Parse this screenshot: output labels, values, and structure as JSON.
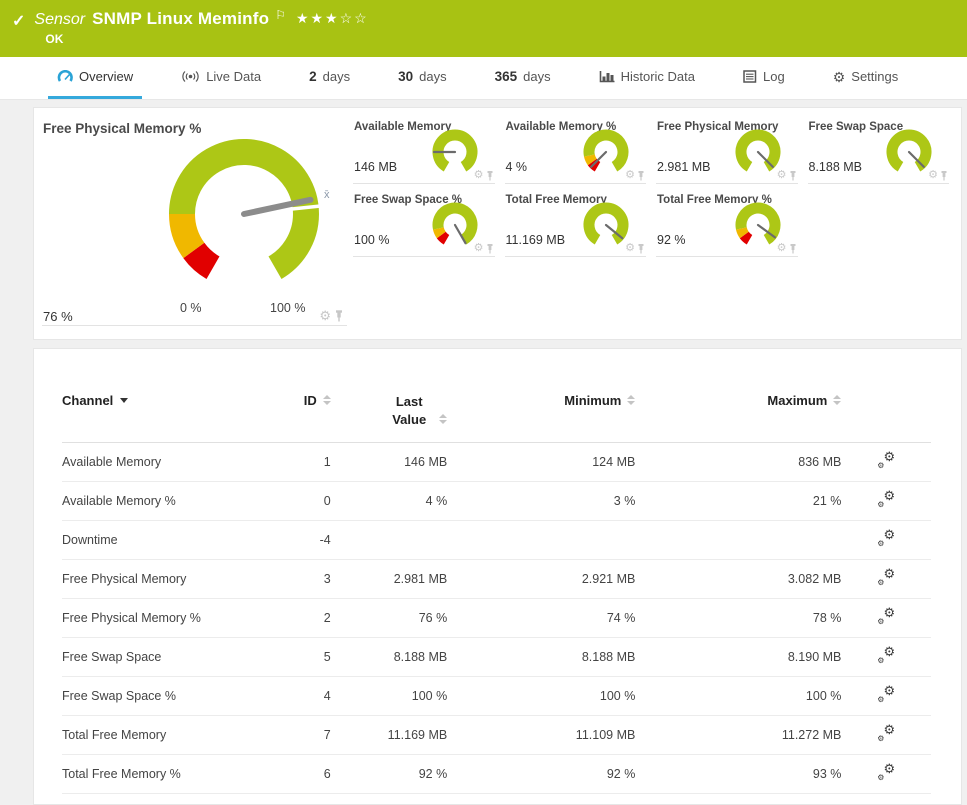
{
  "header": {
    "check_glyph": "✓",
    "type_label": "Sensor",
    "title": "SNMP Linux Meminfo",
    "flag_glyph": "⚐",
    "stars": "★★★☆☆",
    "status": "OK",
    "bg_color": "#a8c213"
  },
  "tabs": [
    {
      "icon": "gauge",
      "num": "",
      "label": "Overview",
      "active": true
    },
    {
      "icon": "live",
      "num": "",
      "label": "Live Data",
      "active": false
    },
    {
      "icon": "",
      "num": "2",
      "label": "days",
      "active": false
    },
    {
      "icon": "",
      "num": "30",
      "label": "days",
      "active": false
    },
    {
      "icon": "",
      "num": "365",
      "label": "days",
      "active": false
    },
    {
      "icon": "chart",
      "num": "",
      "label": "Historic Data",
      "active": false
    },
    {
      "icon": "log",
      "num": "",
      "label": "Log",
      "active": false
    },
    {
      "icon": "gear",
      "num": "",
      "label": "Settings",
      "active": false
    }
  ],
  "gauges": {
    "colors": {
      "green": "#adc716",
      "yellow": "#f0b800",
      "red": "#e10000",
      "needle_main": "#8c8c8c",
      "needle_small": "#6b6b6b"
    },
    "main": {
      "title": "Free Physical Memory %",
      "value": "76 %",
      "min_label": "0 %",
      "max_label": "100 %",
      "mean_marker": "x̄",
      "needle_frac": 0.76,
      "mean_frac": 0.78,
      "segments": "pct"
    },
    "small": [
      {
        "title": "Available Memory",
        "value": "146 MB",
        "needle_frac": 0.2,
        "segments": "plain"
      },
      {
        "title": "Available Memory %",
        "value": "4 %",
        "needle_frac": 0.05,
        "segments": "pct"
      },
      {
        "title": "Free Physical Memory",
        "value": "2.981 MB",
        "needle_frac": 0.95,
        "segments": "plain"
      },
      {
        "title": "Free Swap Space",
        "value": "8.188 MB",
        "needle_frac": 0.95,
        "segments": "plain"
      },
      {
        "title": "Free Swap Space %",
        "value": "100 %",
        "needle_frac": 1.0,
        "segments": "pct"
      },
      {
        "title": "Total Free Memory",
        "value": "11.169 MB",
        "needle_frac": 0.93,
        "segments": "plain"
      },
      {
        "title": "Total Free Memory %",
        "value": "92 %",
        "needle_frac": 0.92,
        "segments": "pct"
      }
    ]
  },
  "table": {
    "columns": {
      "channel": "Channel",
      "id": "ID",
      "last_value": "Last Value",
      "minimum": "Minimum",
      "maximum": "Maximum"
    },
    "rows": [
      {
        "channel": "Available Memory",
        "id": "1",
        "last": "146 MB",
        "min": "124 MB",
        "max": "836 MB"
      },
      {
        "channel": "Available Memory %",
        "id": "0",
        "last": "4 %",
        "min": "3 %",
        "max": "21 %"
      },
      {
        "channel": "Downtime",
        "id": "-4",
        "last": "",
        "min": "",
        "max": ""
      },
      {
        "channel": "Free Physical Memory",
        "id": "3",
        "last": "2.981 MB",
        "min": "2.921 MB",
        "max": "3.082 MB"
      },
      {
        "channel": "Free Physical Memory %",
        "id": "2",
        "last": "76 %",
        "min": "74 %",
        "max": "78 %"
      },
      {
        "channel": "Free Swap Space",
        "id": "5",
        "last": "8.188 MB",
        "min": "8.188 MB",
        "max": "8.190 MB"
      },
      {
        "channel": "Free Swap Space %",
        "id": "4",
        "last": "100 %",
        "min": "100 %",
        "max": "100 %"
      },
      {
        "channel": "Total Free Memory",
        "id": "7",
        "last": "11.169 MB",
        "min": "11.109 MB",
        "max": "11.272 MB"
      },
      {
        "channel": "Total Free Memory %",
        "id": "6",
        "last": "92 %",
        "min": "92 %",
        "max": "93 %"
      }
    ]
  }
}
